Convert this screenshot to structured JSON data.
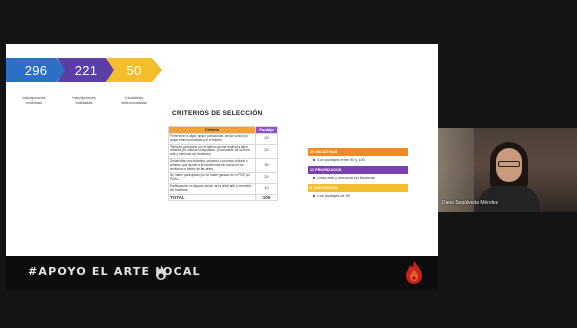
{
  "slide": {
    "stats": [
      {
        "value": "296",
        "label_lines": [
          "Inscripciones",
          "recibidas"
        ],
        "color": "#2d6fc4"
      },
      {
        "value": "221",
        "label_lines": [
          "Inscripciones",
          "validadas"
        ],
        "color": "#5b3fa6"
      },
      {
        "value": "50",
        "label_lines": [
          "Iniciativas",
          "seleccionadas"
        ],
        "color": "#f3be2e"
      }
    ],
    "criteria_title": "CRITERIOS DE SELECCIÓN",
    "table": {
      "headers": [
        "Criterio",
        "Puntaje"
      ],
      "rows": [
        {
          "criterion": "Pertenecer a algún grupo poblacional, sector social y/o grupo étnico priorizado por el talento.",
          "points": "20"
        },
        {
          "criterion": "Territorio priorizado por el talento donde realiza la labor artística y/o cultural comunitaria. (Documento de la línea arte y memoria sin fronteras)",
          "points": "20"
        },
        {
          "criterion": "Desarrollar una iniciativa, proyecto o proceso cultural o artístico que aporte a la transformación social en los territorios a través de las artes.",
          "points": "30"
        },
        {
          "criterion": "No haber participado y/o no haber ganado en el PDE y/o PDAC.",
          "points": "20"
        },
        {
          "criterion": "Participación en alguna acción de la línea arte y memoria sin fronteras.",
          "points": "10"
        }
      ],
      "total_label": "TOTAL",
      "total_value": "100"
    },
    "cards": [
      {
        "header": "39 INICIATIVAS",
        "bullet": "Con puntajes entre 90 y 100",
        "color": "#f08a24"
      },
      {
        "header": "11 PRIORIZADOS",
        "bullet": "Línea arte y memoria sin fronteras",
        "color": "#7b3fb0"
      },
      {
        "header": "8 SUPLENCIAS",
        "bullet": "Con puntajes de 90",
        "color": "#f3be2e"
      }
    ]
  },
  "banner": {
    "text": "#APOYO EL ARTE LOCAL"
  },
  "video": {
    "participant_name": "Dana Sepúlveda Méndez"
  }
}
